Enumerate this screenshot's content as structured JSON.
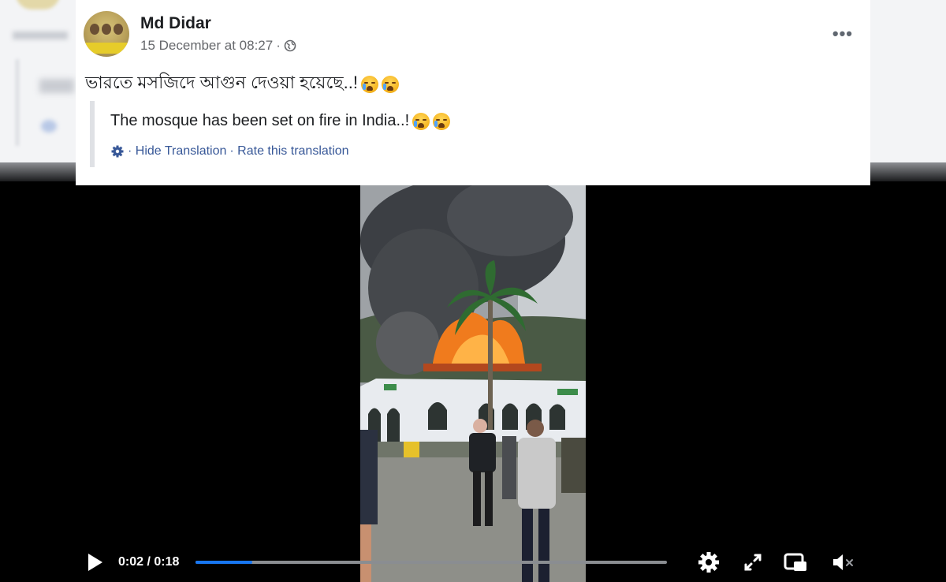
{
  "post": {
    "author": "Md Didar",
    "timestamp": "15 December at 08:27",
    "separator": "·",
    "privacy_icon": "globe-icon",
    "more_icon": "more-options-icon",
    "more_label": "•••",
    "text": "ভারতে  মসজিদে আগুন দেওয়া হয়েছে..!",
    "translation": "The mosque has been set on fire in India..!",
    "hide_translation": "· Hide Translation",
    "rate_translation": "· Rate this translation"
  },
  "video": {
    "time": "0:02 / 0:18",
    "progress": 0.12,
    "icons": [
      "play-icon",
      "settings-icon",
      "fullscreen-icon",
      "picture-in-picture-icon",
      "mute-icon"
    ],
    "accent_color": "#1877f2"
  }
}
